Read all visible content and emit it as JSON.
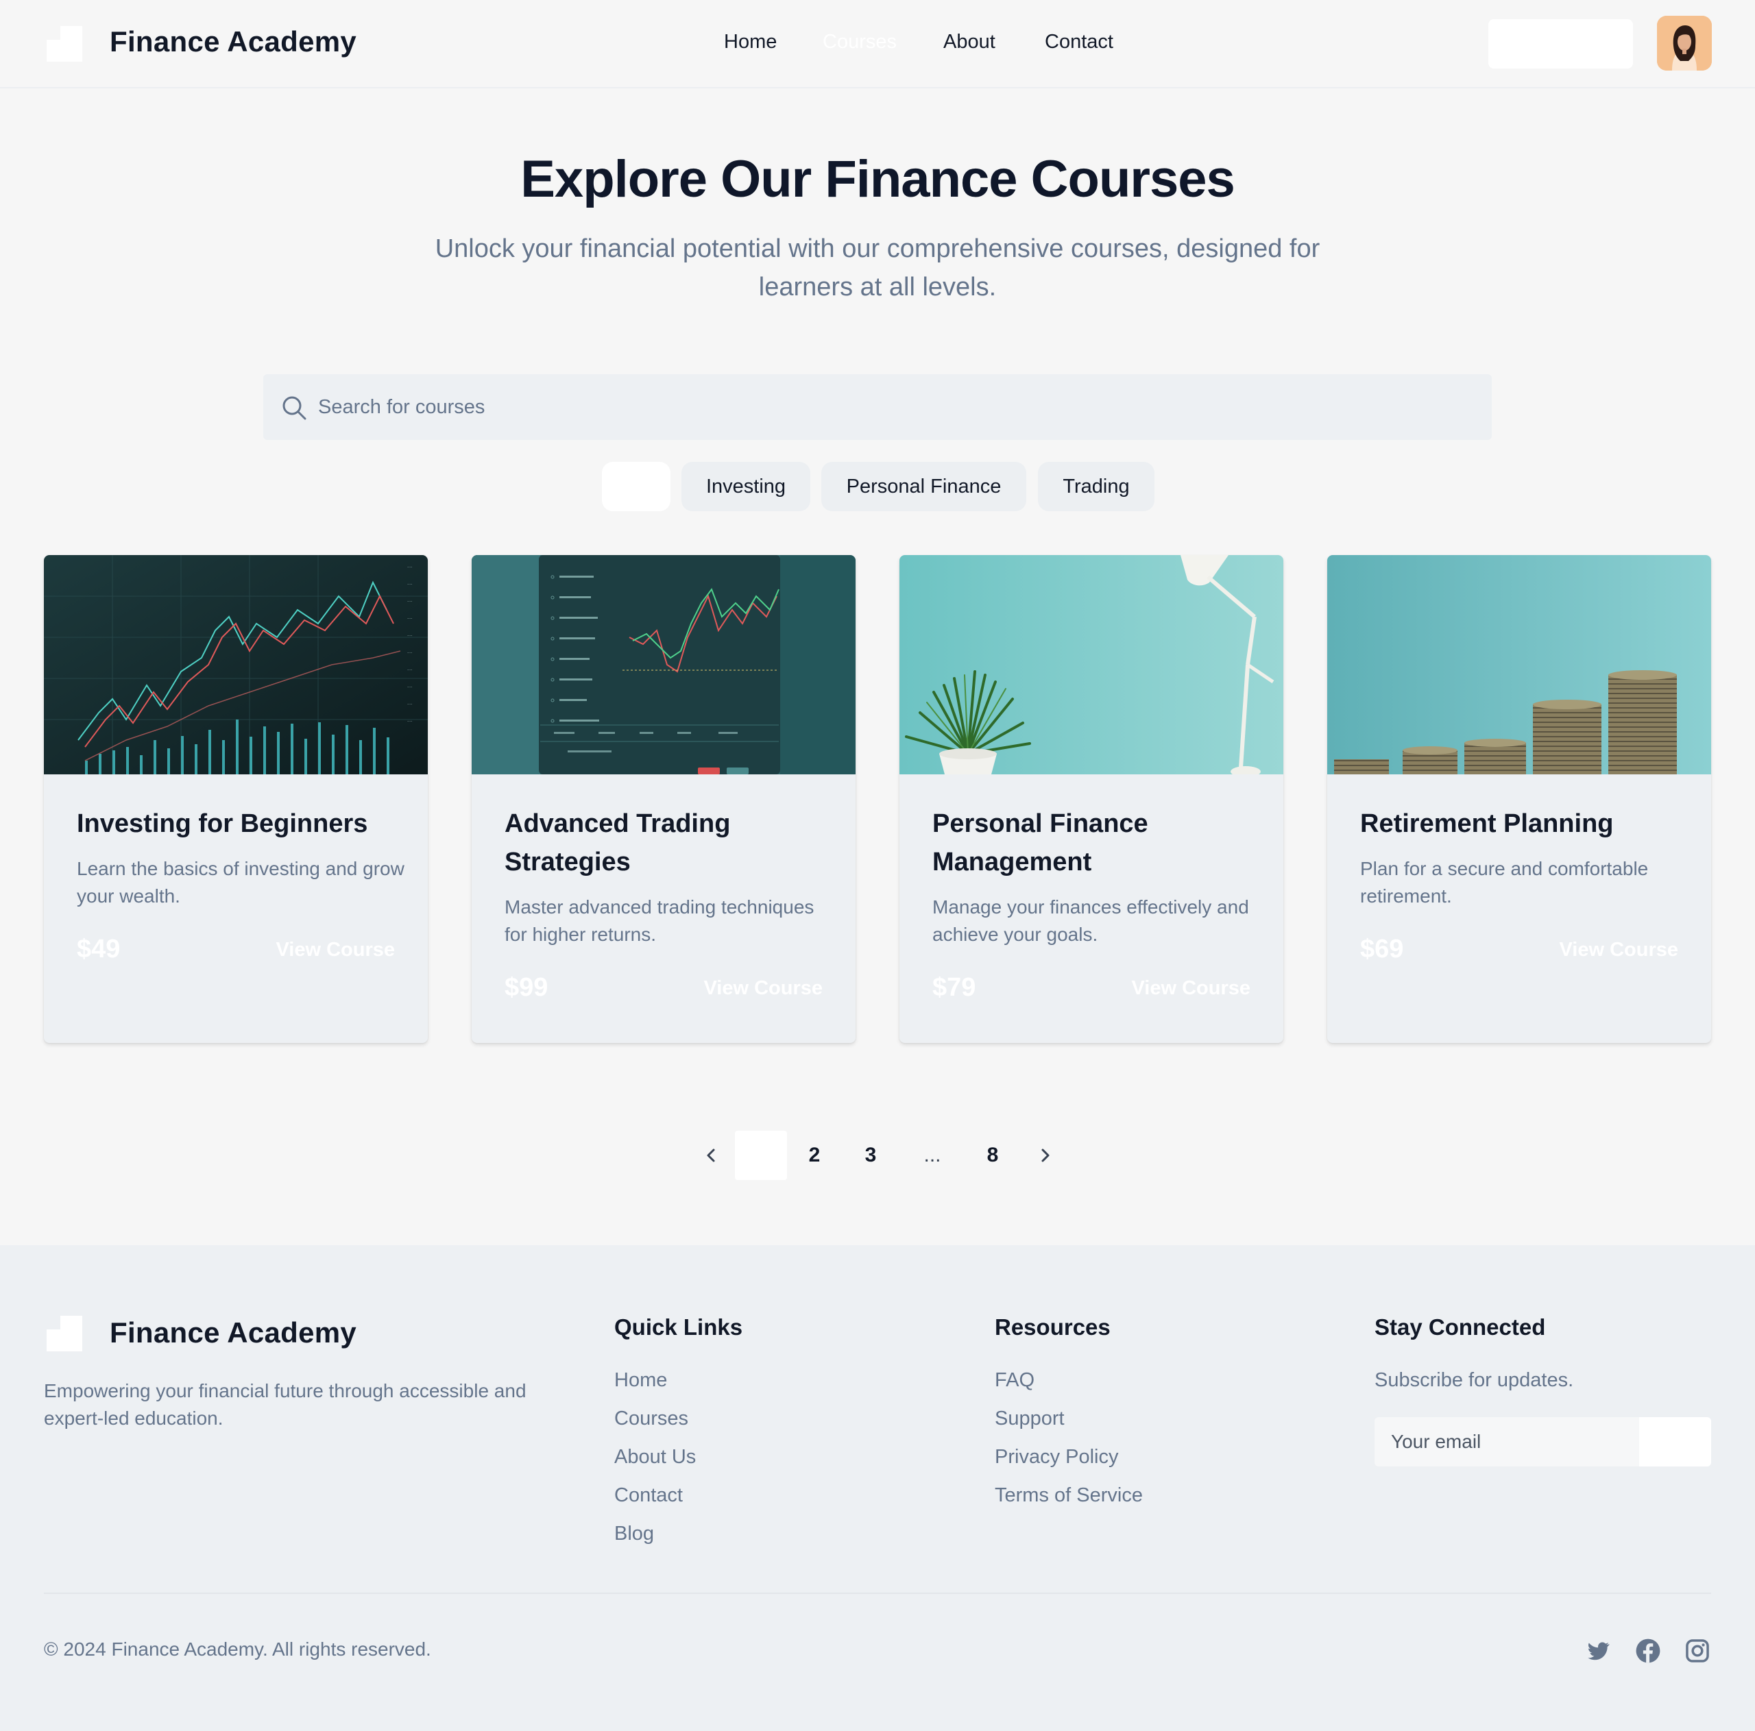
{
  "header": {
    "brand": "Finance Academy",
    "nav": [
      "Home",
      "Courses",
      "About",
      "Contact"
    ],
    "active_nav": "Courses"
  },
  "hero": {
    "title": "Explore Our Finance Courses",
    "subtitle": "Unlock your financial potential with our comprehensive courses, designed for learners at all levels."
  },
  "search": {
    "placeholder": "Search for courses",
    "icon": "search-icon"
  },
  "filters": [
    "",
    "Investing",
    "Personal Finance",
    "Trading"
  ],
  "courses": [
    {
      "title": "Investing for Beginners",
      "description": "Learn the basics of investing and grow your wealth.",
      "price": "$49",
      "cta": "View Course"
    },
    {
      "title": "Advanced Trading Strategies",
      "description": "Master advanced trading techniques for higher returns.",
      "price": "$99",
      "cta": "View Course"
    },
    {
      "title": "Personal Finance Management",
      "description": "Manage your finances effectively and achieve your goals.",
      "price": "$79",
      "cta": "View Course"
    },
    {
      "title": "Retirement Planning",
      "description": "Plan for a secure and comfortable retirement.",
      "price": "$69",
      "cta": "View Course"
    }
  ],
  "pagination": {
    "pages": [
      "",
      "2",
      "3",
      "...",
      "8"
    ],
    "prev_icon": "chevron-left-icon",
    "next_icon": "chevron-right-icon"
  },
  "footer": {
    "brand": "Finance Academy",
    "description": "Empowering your financial future through accessible and expert-led education.",
    "quick_links": {
      "heading": "Quick Links",
      "items": [
        "Home",
        "Courses",
        "About Us",
        "Contact",
        "Blog"
      ]
    },
    "resources": {
      "heading": "Resources",
      "items": [
        "FAQ",
        "Support",
        "Privacy Policy",
        "Terms of Service"
      ]
    },
    "stay_connected": {
      "heading": "Stay Connected",
      "text": "Subscribe for updates.",
      "email_placeholder": "Your email"
    },
    "copyright": "© 2024 Finance Academy. All rights reserved.",
    "social": [
      "twitter-icon",
      "facebook-icon",
      "instagram-icon"
    ]
  },
  "colors": {
    "background": "#f6f6f6",
    "card": "#edf0f3",
    "heading": "#0f172a",
    "muted": "#64748b",
    "teal": "#7cc9cc"
  }
}
